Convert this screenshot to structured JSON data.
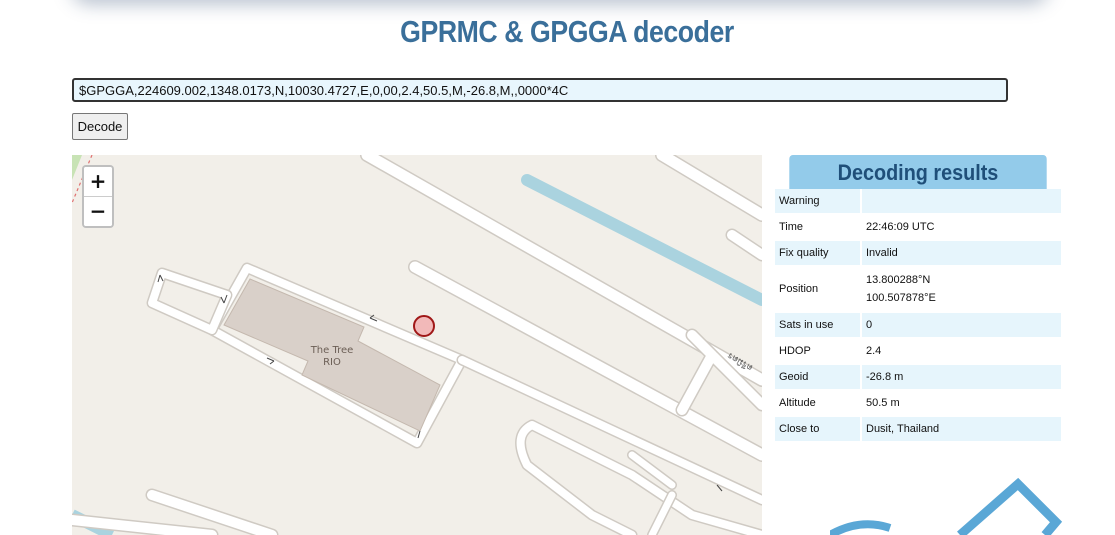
{
  "header": {
    "title": "GPRMC & GPGGA decoder"
  },
  "form": {
    "sentence_value": "$GPGGA,224609.002,1348.0173,N,10030.4727,E,0,00,2.4,50.5,M,-26.8,M,,0000*4C",
    "decode_label": "Decode"
  },
  "map": {
    "zoom_in": "+",
    "zoom_out": "−",
    "building_label_line1": "The Tree",
    "building_label_line2": "RIO",
    "street_label": "ตรีมิตร",
    "marker_icon": "location-marker-icon",
    "colors": {
      "background": "#f2efe9",
      "water": "#aad3df",
      "building": "#d9d0c9",
      "marker": "#f2b9b9"
    }
  },
  "results": {
    "title": "Decoding results",
    "rows": [
      {
        "label": "Warning",
        "value": ""
      },
      {
        "label": "Time",
        "value": "22:46:09 UTC"
      },
      {
        "label": "Fix quality",
        "value": "Invalid"
      },
      {
        "label": "Position",
        "value": "13.800288°N",
        "value2": "100.507878°E"
      },
      {
        "label": "Sats in use",
        "value": "0"
      },
      {
        "label": "HDOP",
        "value": "2.4"
      },
      {
        "label": "Geoid",
        "value": "-26.8 m"
      },
      {
        "label": "Altitude",
        "value": "50.5 m"
      },
      {
        "label": "Close to",
        "value": "Dusit, Thailand"
      }
    ]
  },
  "colors": {
    "title": "#3a6f9a",
    "results_header_bg": "#93cbea",
    "results_header_text": "#1f4f79",
    "row_alt": "#e6f5fc"
  }
}
